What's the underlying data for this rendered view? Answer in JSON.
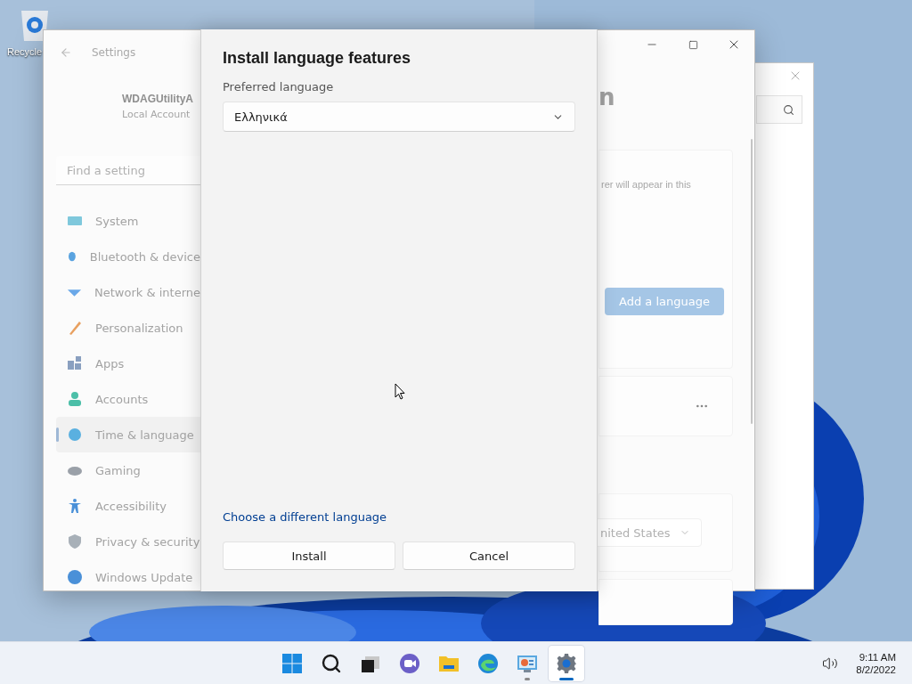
{
  "desktop": {
    "icons": [
      {
        "label": "Recycle"
      }
    ]
  },
  "settings_window": {
    "title": "Settings",
    "account": {
      "name": "WDAGUtilityA",
      "type": "Local Account"
    },
    "search": {
      "placeholder": "Find a setting"
    },
    "nav": [
      {
        "label": "System",
        "selected": false
      },
      {
        "label": "Bluetooth & device",
        "selected": false
      },
      {
        "label": "Network & interne",
        "selected": false
      },
      {
        "label": "Personalization",
        "selected": false
      },
      {
        "label": "Apps",
        "selected": false
      },
      {
        "label": "Accounts",
        "selected": false
      },
      {
        "label": "Time & language",
        "selected": true
      },
      {
        "label": "Gaming",
        "selected": false
      },
      {
        "label": "Accessibility",
        "selected": false
      },
      {
        "label": "Privacy & security",
        "selected": false
      },
      {
        "label": "Windows Update",
        "selected": false
      }
    ],
    "content": {
      "heading": "n",
      "description": "rer will appear in this",
      "add_button": "Add a language",
      "region_value": "nited States"
    }
  },
  "dialog": {
    "title": "Install language features",
    "label": "Preferred language",
    "value": "Ελληνικά",
    "link": "Choose a different language",
    "buttons": [
      {
        "label": "Install"
      },
      {
        "label": "Cancel"
      }
    ]
  },
  "taskbar": {
    "apps": [
      {
        "running": false,
        "active": false
      },
      {
        "running": false,
        "active": false
      },
      {
        "running": false,
        "active": false
      },
      {
        "running": false,
        "active": false
      },
      {
        "running": false,
        "active": false
      },
      {
        "running": false,
        "active": false
      },
      {
        "running": true,
        "active": false
      },
      {
        "running": true,
        "active": true
      }
    ],
    "clock": {
      "time": "9:11 AM",
      "date": "8/2/2022"
    }
  }
}
